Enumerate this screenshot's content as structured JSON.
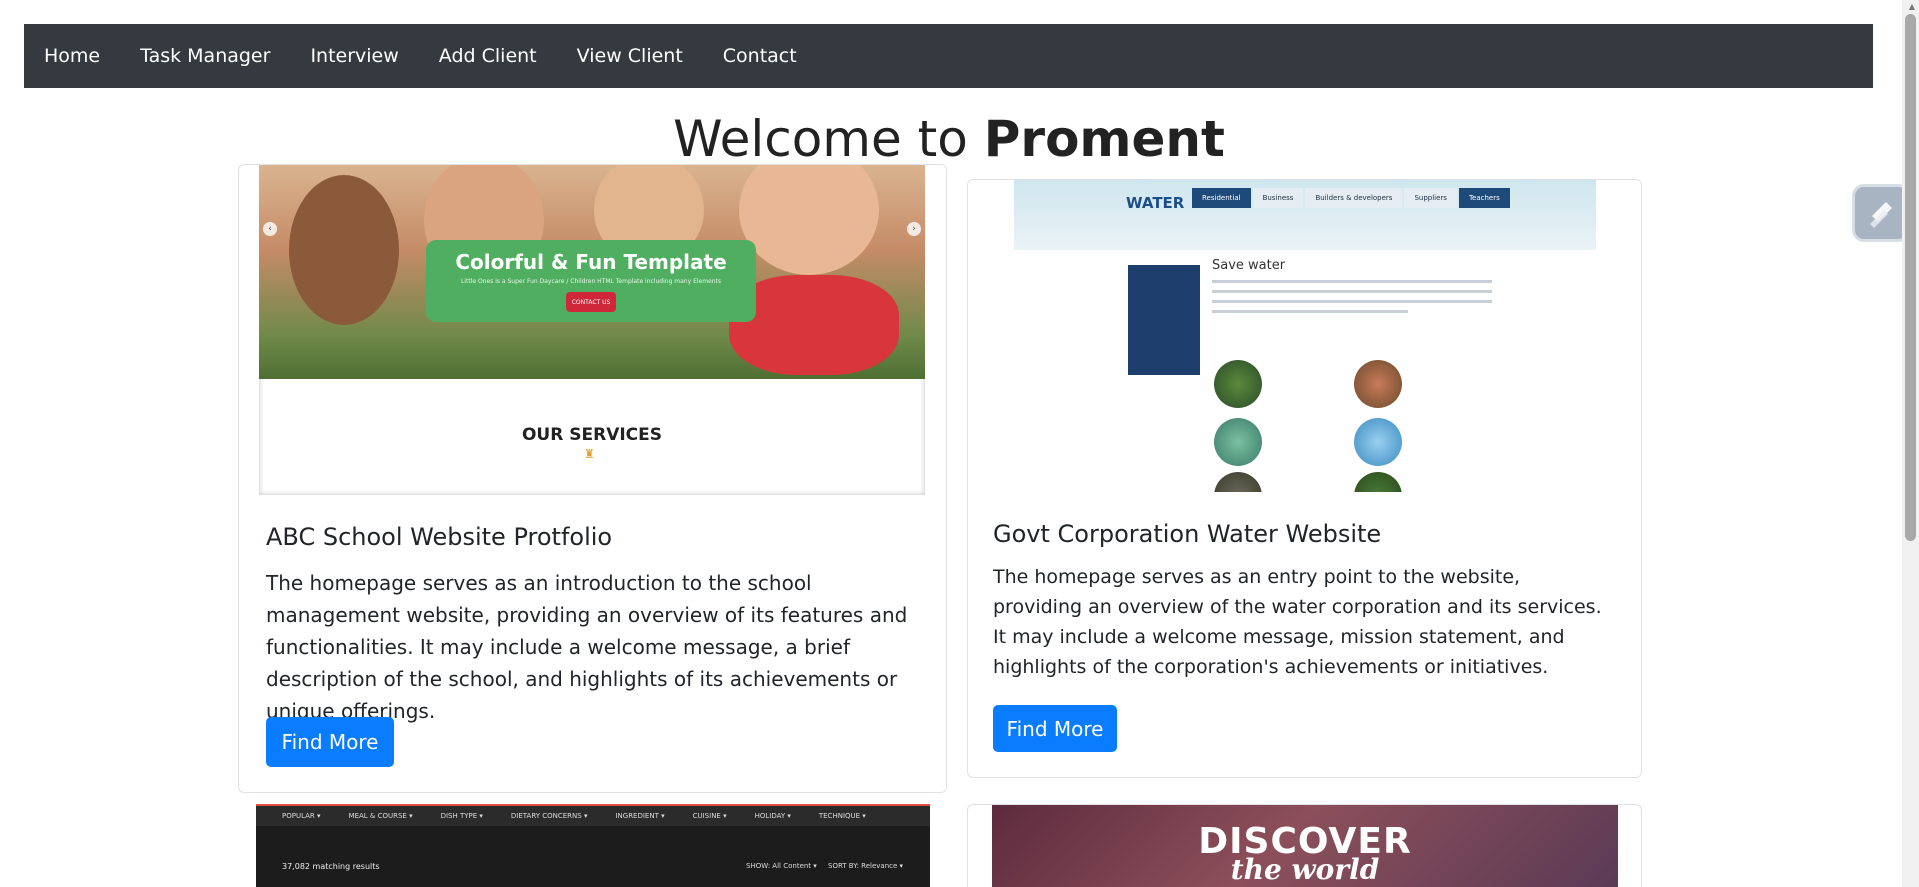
{
  "nav": {
    "items": [
      "Home",
      "Task Manager",
      "Interview",
      "Add Client",
      "View Client",
      "Contact"
    ]
  },
  "heading": {
    "prefix": "Welcome to ",
    "brand": "Proment"
  },
  "cards": [
    {
      "title": "ABC School Website Protfolio",
      "text": "The homepage serves as an introduction to the school management website, providing an overview of its features and functionalities. It may include a welcome message, a brief description of the school, and highlights of its achievements or unique offerings.",
      "button": "Find More",
      "preview": {
        "banner_title": "Colorful & Fun Template",
        "banner_sub": "Little Ones is a Super Fun Daycare / Children HTML Template including many Elements",
        "banner_button": "CONTACT US",
        "section": "OUR SERVICES"
      }
    },
    {
      "title": "Govt Corporation Water Website",
      "text": "The homepage serves as an entry point to the website, providing an overview of the water corporation and its services. It may include a welcome message, mission statement, and highlights of the corporation's achievements or initiatives.",
      "button": "Find More",
      "preview": {
        "logo": "WATER",
        "tabs": [
          "Residential",
          "Business",
          "Builders & developers",
          "Suppliers",
          "Teachers"
        ],
        "heading": "Save water"
      }
    },
    {
      "preview": {
        "menu": [
          "POPULAR ▾",
          "MEAL & COURSE ▾",
          "DISH TYPE ▾",
          "DIETARY CONCERNS ▾",
          "INGREDIENT ▾",
          "CUISINE ▾",
          "HOLIDAY ▾",
          "TECHNIQUE ▾"
        ],
        "count": "37,082 matching results",
        "show": "SHOW: All Content ▾",
        "sort": "SORT BY: Relevance ▾"
      }
    },
    {
      "preview": {
        "line1": "DISCOVER",
        "line2": "the world"
      }
    }
  ],
  "colors": {
    "navbar": "#343a40",
    "button": "#0a7cff"
  }
}
